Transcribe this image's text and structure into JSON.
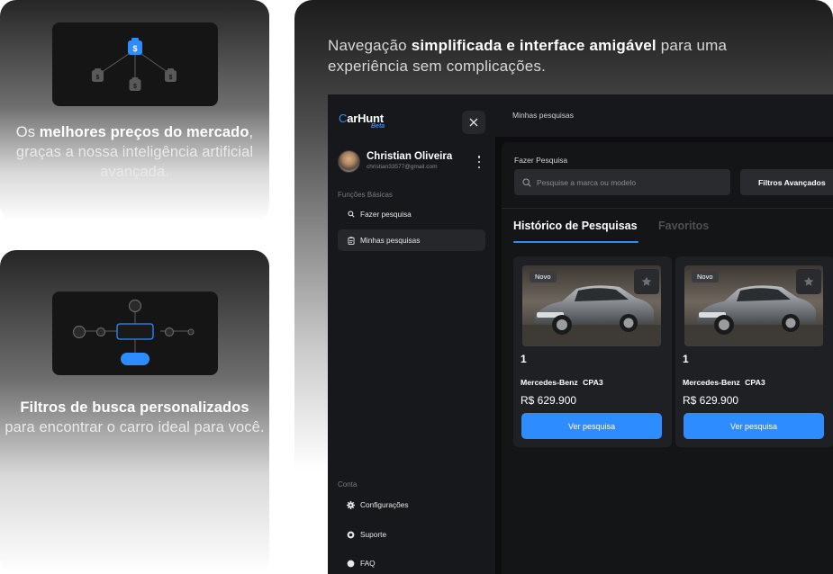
{
  "colors": {
    "accent": "#2d8cff",
    "app_bg": "#0d0d0f",
    "sidebar_bg": "#17181b"
  },
  "feature_cards": [
    {
      "text_light": "Os ",
      "text_bold": "melhores preços do mercado",
      "text_light2": ", ",
      "text_fade": "graças a nossa inteligência artificial avançada."
    },
    {
      "text_bold": "Filtros de busca personalizados",
      "text_fade": "para encontrar o carro ideal para você."
    }
  ],
  "headline": {
    "part1": "Navegação ",
    "bold": "simplificada e interface amigável",
    "part2": " para uma experiência sem complicações."
  },
  "app": {
    "logo_c": "C",
    "logo_rest": "arHunt",
    "logo_beta": "Beta",
    "user": {
      "name": "Christian Oliveira",
      "email": "christian33577@gmail.com"
    },
    "sidebar": {
      "section_basic": "Funções Básicas",
      "basic_items": [
        {
          "label": "Fazer pesquisa",
          "icon": "search-icon"
        },
        {
          "label": "Minhas pesquisas",
          "icon": "clipboard-icon"
        }
      ],
      "section_account": "Conta",
      "account_items": [
        {
          "label": "Configurações",
          "icon": "gear-icon"
        },
        {
          "label": "Suporte",
          "icon": "support-icon"
        },
        {
          "label": "FAQ",
          "icon": "help-icon"
        }
      ]
    },
    "topbar_title": "Minhas pesquisas",
    "search": {
      "label": "Fazer Pesquisa",
      "placeholder": "Pesquise a marca ou modelo",
      "advanced_button": "Filtros Avançados"
    },
    "tabs": [
      "Histórico de Pesquisas",
      "Favoritos"
    ],
    "results": [
      {
        "badge": "Novo",
        "count": "1",
        "brand": "Mercedes-Benz",
        "model": "CPA3",
        "price": "R$ 629.900",
        "button": "Ver pesquisa"
      },
      {
        "badge": "Novo",
        "count": "1",
        "brand": "Mercedes-Benz",
        "model": "CPA3",
        "price": "R$ 629.900",
        "button": "Ver pesquisa"
      }
    ]
  }
}
